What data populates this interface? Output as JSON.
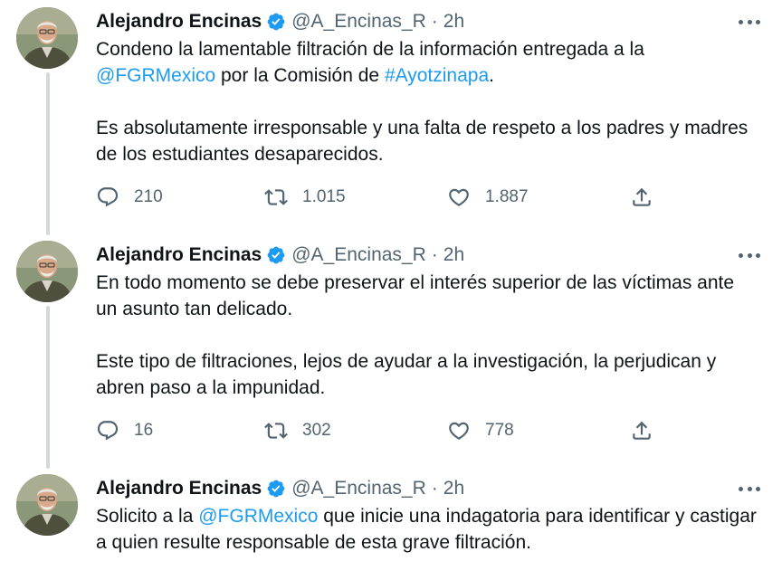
{
  "colors": {
    "accent": "#1d9bf0",
    "text": "#0f1419",
    "secondary": "#536471",
    "thread_line": "#cfd9de"
  },
  "icons": {
    "reply": "reply-icon",
    "retweet": "retweet-icon",
    "like": "heart-icon",
    "share": "share-icon",
    "more": "more-icon",
    "verified": "verified-badge-icon"
  },
  "tweets": [
    {
      "author": {
        "name": "Alejandro Encinas",
        "handle": "@A_Encinas_R"
      },
      "separator": "·",
      "time": "2h",
      "text": {
        "p1_a": "Condeno la lamentable filtración de la información entregada a la",
        "p1_mention": "@FGRMexico",
        "p1_b": " por la Comisión de ",
        "p1_hashtag": "#Ayotzinapa",
        "p1_c": ".",
        "p2": "Es absolutamente irresponsable y una falta de respeto a los padres y madres de los estudiantes desaparecidos."
      },
      "stats": {
        "replies": "210",
        "retweets": "1.015",
        "likes": "1.887"
      }
    },
    {
      "author": {
        "name": "Alejandro Encinas",
        "handle": "@A_Encinas_R"
      },
      "separator": "·",
      "time": "2h",
      "text": {
        "p1": "En todo momento se debe preservar el interés superior de las víctimas ante un asunto tan delicado.",
        "p2": "Este tipo de filtraciones, lejos de ayudar a la investigación, la perjudican y abren paso a la impunidad."
      },
      "stats": {
        "replies": "16",
        "retweets": "302",
        "likes": "778"
      }
    },
    {
      "author": {
        "name": "Alejandro Encinas",
        "handle": "@A_Encinas_R"
      },
      "separator": "·",
      "time": "2h",
      "text": {
        "p1_a": "Solicito a la ",
        "p1_mention": "@FGRMexico",
        "p1_b": " que inicie una indagatoria para identificar y castigar a quien resulte responsable de esta grave filtración."
      }
    }
  ]
}
